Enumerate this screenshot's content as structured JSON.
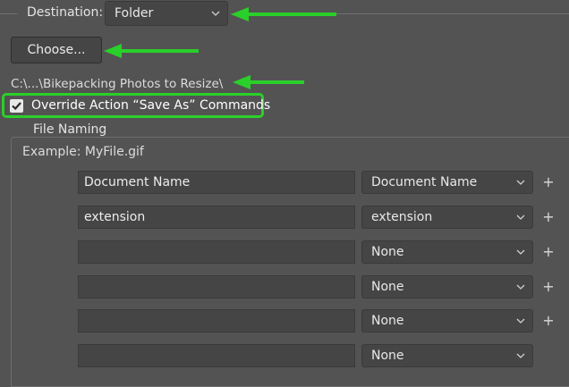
{
  "destination": {
    "label": "Destination:",
    "selected": "Folder"
  },
  "choose_button": "Choose...",
  "path": "C:\\...\\Bikepacking Photos to Resize\\",
  "override": {
    "label": "Override Action “Save As” Commands",
    "checked": true
  },
  "file_naming": {
    "legend": "File Naming",
    "example": "Example: MyFile.gif",
    "rows": [
      {
        "text": "Document Name",
        "select": "Document Name",
        "plus": "+"
      },
      {
        "text": "extension",
        "select": "extension",
        "plus": "+"
      },
      {
        "text": "",
        "select": "None",
        "plus": "+"
      },
      {
        "text": "",
        "select": "None",
        "plus": "+"
      },
      {
        "text": "",
        "select": "None",
        "plus": "+"
      },
      {
        "text": "",
        "select": "None",
        "plus": ""
      }
    ]
  },
  "colors": {
    "background": "#535353",
    "control": "#454545",
    "highlight": "#2ad02a"
  },
  "icons": [
    "chevron-down-icon",
    "checkmark-icon",
    "plus-icon",
    "annotation-arrow-icon"
  ]
}
